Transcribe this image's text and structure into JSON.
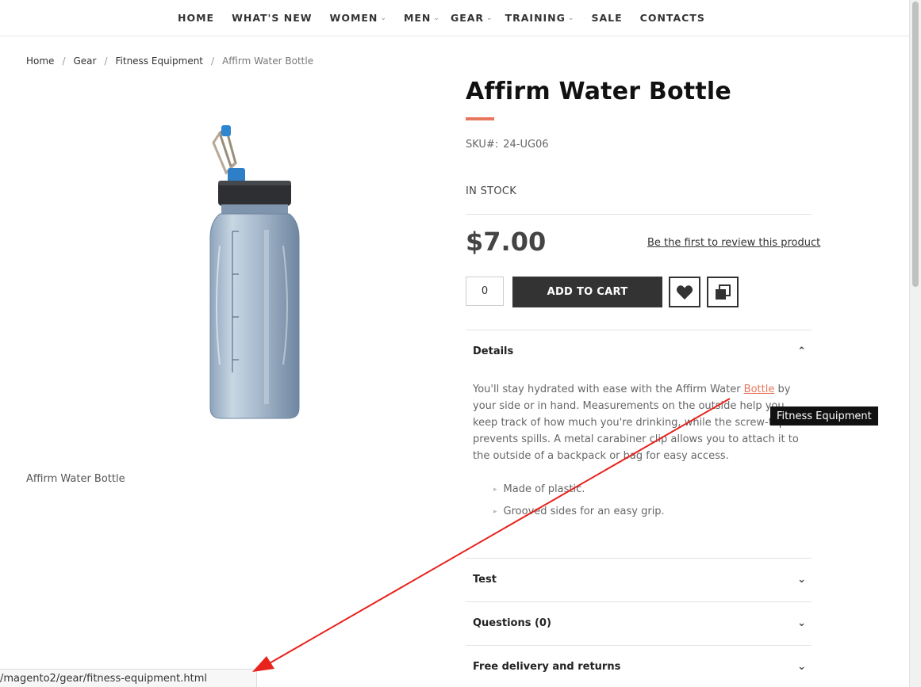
{
  "nav": {
    "items": [
      {
        "label": "HOME",
        "has_dropdown": false
      },
      {
        "label": "WHAT'S NEW",
        "has_dropdown": false
      },
      {
        "label": "WOMEN",
        "has_dropdown": true
      },
      {
        "label": "MEN",
        "has_dropdown": true
      },
      {
        "label": "GEAR",
        "has_dropdown": true
      },
      {
        "label": "TRAINING",
        "has_dropdown": true
      },
      {
        "label": "SALE",
        "has_dropdown": false
      },
      {
        "label": "CONTACTS",
        "has_dropdown": false
      }
    ]
  },
  "breadcrumb": {
    "items": [
      "Home",
      "Gear",
      "Fitness Equipment"
    ],
    "current": "Affirm Water Bottle",
    "separator": "/"
  },
  "gallery": {
    "image": "water-bottle-image",
    "caption": "Affirm Water Bottle"
  },
  "product": {
    "title": "Affirm Water Bottle",
    "sku_label": "SKU#:",
    "sku_value": "24-UG06",
    "stock": "IN STOCK",
    "price": "$7.00",
    "review_link": "Be the first to review this product",
    "qty": "0",
    "add_to_cart": "ADD TO CART",
    "accent_color": "#e8765e"
  },
  "accordion": {
    "details": {
      "title": "Details",
      "text_before": "You'll stay hydrated with ease with the Affirm Water ",
      "link_text": "Bottle",
      "text_after": " by your side or in hand. Measurements on the outside help you keep track of how much you're drinking, while the screw-top lid prevents spills. A metal carabiner clip allows you to attach it to the outside of a backpack or bag for easy access.",
      "bullets": [
        "Made of plastic.",
        "Grooved sides for an easy grip."
      ]
    },
    "sections": [
      "Test",
      "Questions (0)",
      "Free delivery and returns"
    ]
  },
  "tooltip": "Fitness Equipment",
  "status_bar": "/magento2/gear/fitness-equipment.html",
  "annotation": {
    "arrow_color": "#e8221c"
  }
}
